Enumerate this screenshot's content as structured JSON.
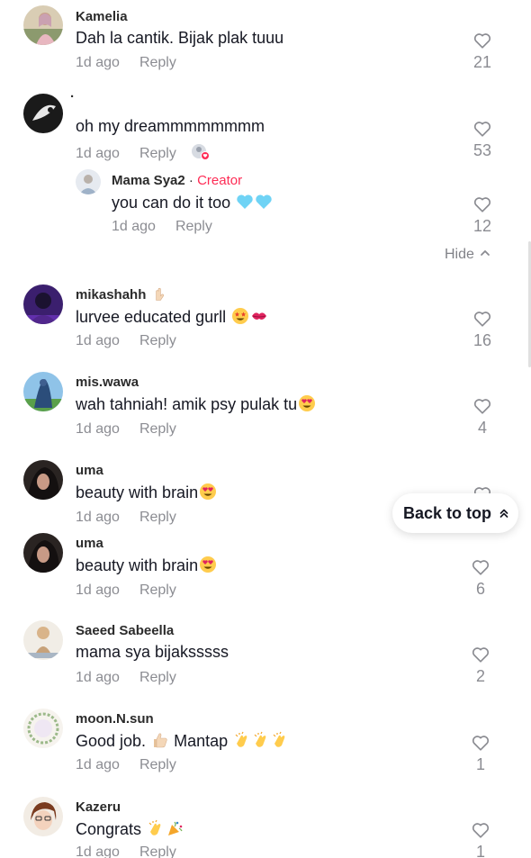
{
  "comments": [
    {
      "username": "Kamelia",
      "text": "Dah la cantik. Bijak plak tuuu",
      "time": "1d ago",
      "reply": "Reply",
      "likes": "21",
      "avatar": "avatar-kamelia"
    },
    {
      "username": "·",
      "text": "oh my dreammmmmmmm",
      "time": "1d ago",
      "reply": "Reply",
      "likes": "53",
      "avatar": "avatar-dot"
    },
    {
      "username": "Mama Sya2",
      "badge": "Creator",
      "separator": "·",
      "text": "you can do it too",
      "time": "1d ago",
      "reply": "Reply",
      "likes": "12",
      "avatar": "avatar-mamasya"
    },
    {
      "username": "mikashahh",
      "text": "lurvee educated gurll",
      "time": "1d ago",
      "reply": "Reply",
      "likes": "16",
      "avatar": "avatar-mikashahh"
    },
    {
      "username": "mis.wawa",
      "text": "wah tahniah! amik psy pulak tu",
      "time": "1d ago",
      "reply": "Reply",
      "likes": "4",
      "avatar": "avatar-miswawa"
    },
    {
      "username": "uma",
      "text": "beauty with brain",
      "time": "1d ago",
      "reply": "Reply",
      "likes": "",
      "avatar": "avatar-uma"
    },
    {
      "username": "uma",
      "text": "beauty with brain",
      "time": "1d ago",
      "reply": "Reply",
      "likes": "6",
      "avatar": "avatar-uma"
    },
    {
      "username": "Saeed Sabeella",
      "text": "mama sya bijaksssss",
      "time": "1d ago",
      "reply": "Reply",
      "likes": "2",
      "avatar": "avatar-saeed"
    },
    {
      "username": "moon.N.sun",
      "text": "Good job.",
      "text2": "Mantap",
      "time": "1d ago",
      "reply": "Reply",
      "likes": "1",
      "avatar": "avatar-moon"
    },
    {
      "username": "Kazeru",
      "text": "Congrats",
      "time": "1d ago",
      "reply": "Reply",
      "likes": "1",
      "avatar": "avatar-kazeru"
    }
  ],
  "replies": {
    "hide_label": "Hide"
  },
  "back_to_top": "Back to top",
  "colors": {
    "creator": "#fe2c55",
    "muted": "#8a8b91",
    "text": "#161823"
  },
  "icons": [
    "heart-outline-icon",
    "chevron-up-icon",
    "double-chevron-up-icon"
  ]
}
